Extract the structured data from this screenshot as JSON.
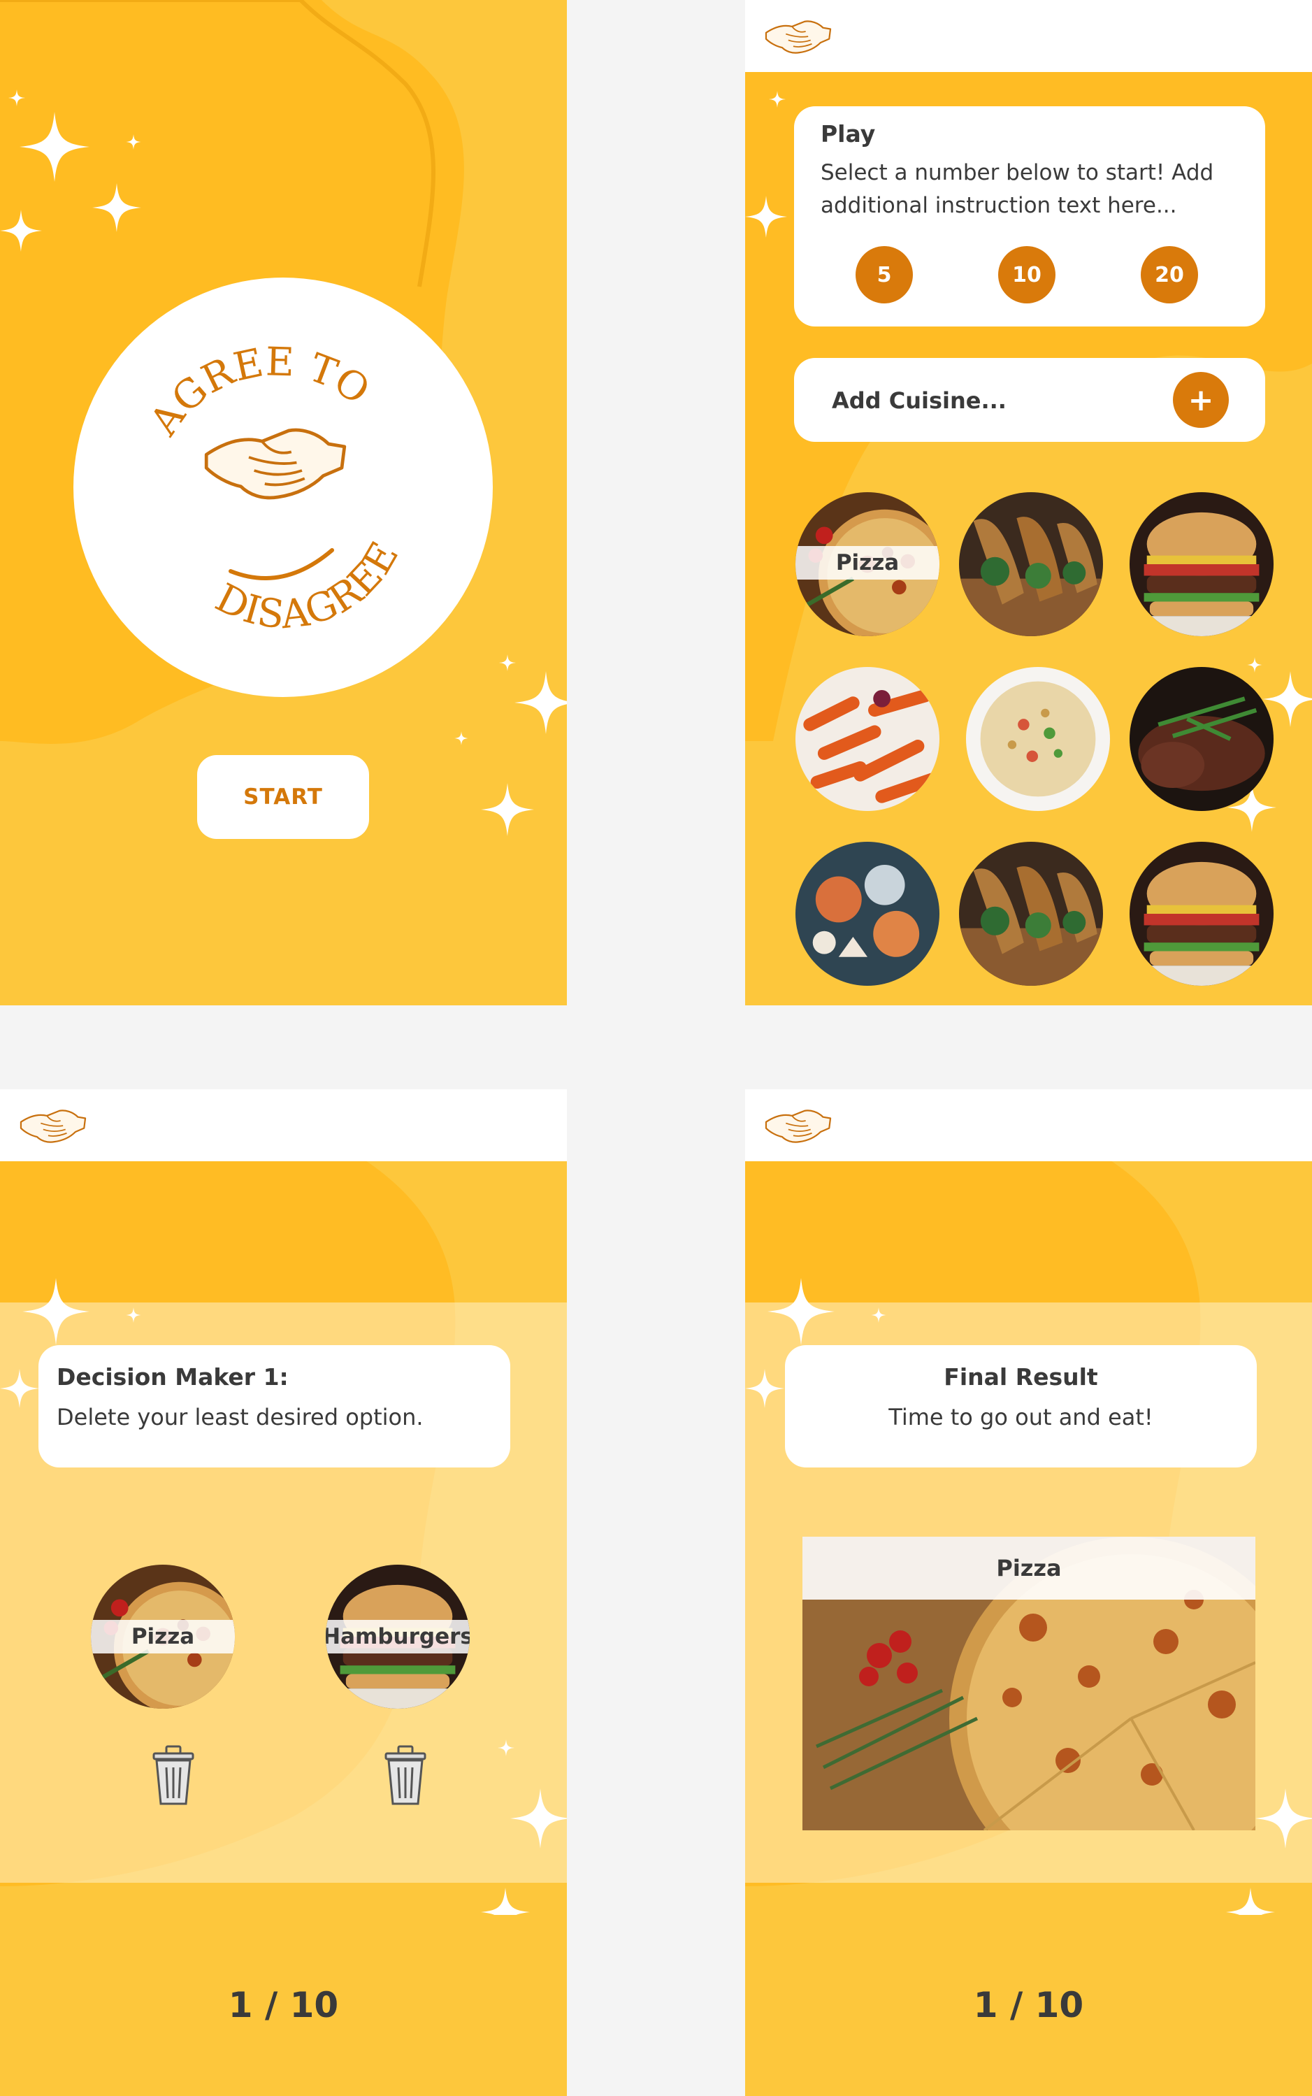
{
  "colors": {
    "honey": "#fdc73c",
    "accent": "#d97a0b",
    "text": "#3a3a3a",
    "white": "#ffffff"
  },
  "start_screen": {
    "logo_top": "AGREE TO",
    "logo_bottom": "DISAGREE",
    "start_label": "START"
  },
  "play_screen": {
    "title": "Play",
    "instructions": "Select a number below to start! Add additional instruction text here...",
    "number_options": [
      "5",
      "10",
      "20"
    ],
    "cuisine_placeholder": "Add Cuisine...",
    "add_icon": "plus-icon",
    "food_grid": [
      {
        "label": "Pizza",
        "icon": "pizza-photo"
      },
      {
        "label": "",
        "icon": "tacos-photo"
      },
      {
        "label": "",
        "icon": "burger-photo"
      },
      {
        "label": "",
        "icon": "pasta-photo"
      },
      {
        "label": "",
        "icon": "fried-rice-photo"
      },
      {
        "label": "",
        "icon": "steak-photo"
      },
      {
        "label": "",
        "icon": "seafood-photo"
      },
      {
        "label": "",
        "icon": "tacos-photo"
      },
      {
        "label": "",
        "icon": "burger-photo"
      }
    ]
  },
  "decision_screen": {
    "title": "Decision Maker 1:",
    "instructions": "Delete your least desired option.",
    "options": [
      {
        "label": "Pizza",
        "delete_icon": "trash-icon"
      },
      {
        "label": "Hamburgers",
        "delete_icon": "trash-icon"
      }
    ],
    "counter": "1 / 10"
  },
  "result_screen": {
    "title": "Final Result",
    "message": "Time to go out and eat!",
    "winner": "Pizza",
    "counter": "1 / 10"
  }
}
